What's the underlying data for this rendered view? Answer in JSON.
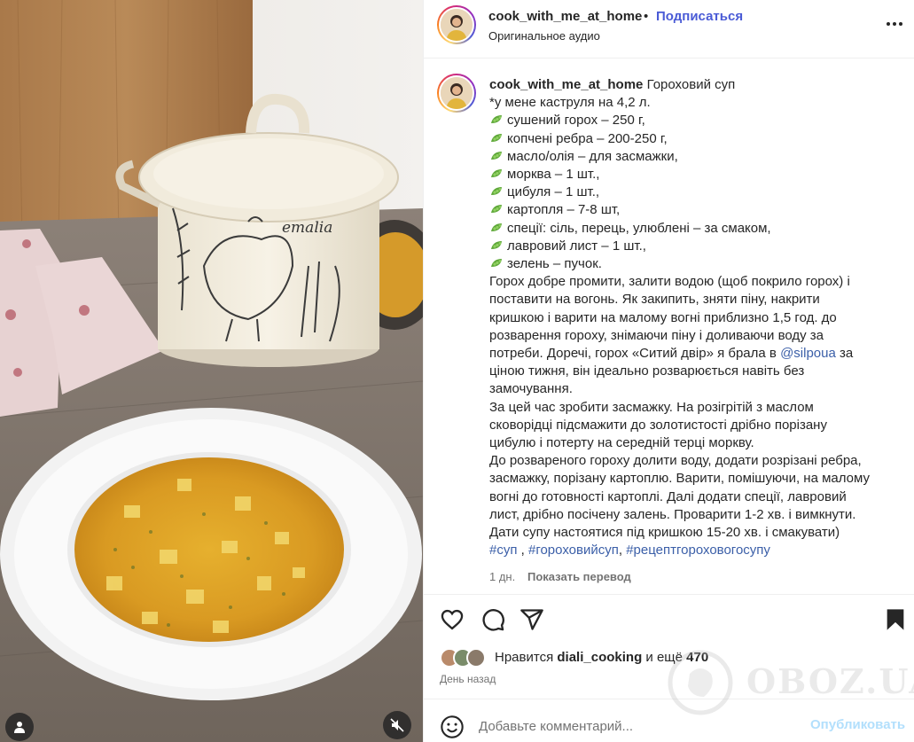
{
  "media": {
    "pot_brand": "emalia",
    "user_icon": "user-tag-icon",
    "mute_icon": "audio-muted-icon"
  },
  "header": {
    "username": "cook_with_me_at_home",
    "separator": "•",
    "follow_label": "Подписаться",
    "audio_label": "Оригинальное аудио",
    "more_icon": "more-horizontal-icon"
  },
  "caption": {
    "username": "cook_with_me_at_home",
    "title": "Гороховий суп",
    "pot_note": "*у мене каструля на 4,2 л.",
    "ingredients": [
      "сушений горох – 250 г,",
      "копчені ребра – 200-250 г,",
      "масло/олія – для засмажки,",
      "морква – 1 шт.,",
      "цибуля – 1 шт.,",
      "картопля – 7-8 шт,",
      "спеції: сіль, перець, улюблені – за смаком,",
      "лавровий лист – 1 шт.,",
      "зелень – пучок."
    ],
    "lines": [
      "Горох добре промити, залити водою (щоб покрило горох) і",
      "поставити на вогонь. Як закипить, зняти піну, накрити",
      "кришкою і варити на малому вогні приблизно 1,5 год. до",
      "розварення гороху, знімаючи піну і доливаючи воду за",
      "потреби. Доречі, горох «Ситий двір» я брала в",
      "ціною тижня, він ідеально розварюється навіть без",
      "замочування.",
      "За цей час зробити засмажку. На розігрітій з маслом",
      "сковорідці підсмажити до золотистості дрібно порізану",
      "цибулю і потерту на середній терці моркву.",
      "До розвареного гороху долити воду, додати розрізані ребра,",
      "засмажку, порізану картоплю. Варити, помішуючи, на малому",
      "вогні до готовності картоплі. Далі додати спеції, лавровий",
      "лист, дрібно посічену залень. Проварити 1-2 хв. і вимкнути.",
      "Дати супу настоятися під кришкою 15-20 хв. і смакувати)"
    ],
    "mention": "@silpoua",
    "mention_suffix": "за",
    "hashtags": [
      "#суп",
      "#гороховийсуп",
      "#рецептгороховогосупу"
    ],
    "hashtag_sep": " , ",
    "hashtag_sep2": ", ",
    "age": "1 дн.",
    "translate_label": "Показать перевод"
  },
  "actions": {
    "like_icon": "heart-icon",
    "comment_icon": "comment-icon",
    "share_icon": "share-icon",
    "save_icon": "bookmark-icon"
  },
  "likes": {
    "prefix": "Нравится",
    "user": "diali_cooking",
    "middle": "и ещё",
    "count": "470",
    "time": "День назад"
  },
  "comment": {
    "emoji_icon": "emoji-icon",
    "placeholder": "Добавьте комментарий...",
    "publish_label": "Опубликовать"
  },
  "watermark": {
    "text": "OBOZ.UA"
  },
  "colors": {
    "link": "#4a5bd6",
    "mention": "#3b5fa8",
    "muted": "#737373",
    "publish_disabled": "#b2dffc",
    "pea_green": "#5fa83a"
  }
}
